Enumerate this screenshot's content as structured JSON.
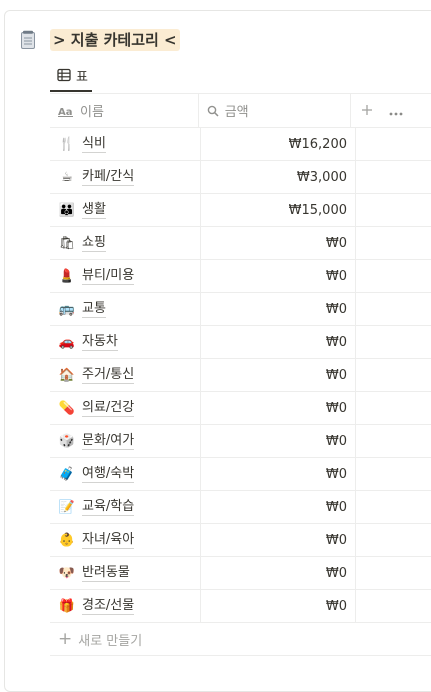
{
  "database": {
    "title": "> 지출 카테고리 <",
    "icon": "notepad-icon"
  },
  "view": {
    "tab_label": "표",
    "tab_icon": "table-icon"
  },
  "columns": {
    "name": {
      "label": "이름",
      "icon": "text-property-icon"
    },
    "amount": {
      "label": "금액",
      "icon": "search-icon"
    },
    "add_icon": "plus-icon",
    "more_icon": "more-horizontal-icon"
  },
  "rows": [
    {
      "emoji": "🍴",
      "name": "식비",
      "amount": "₩16,200"
    },
    {
      "emoji": "☕",
      "name": "카페/간식",
      "amount": "₩3,000"
    },
    {
      "emoji": "👪",
      "name": "생활",
      "amount": "₩15,000"
    },
    {
      "emoji": "🛍",
      "name": "쇼핑",
      "amount": "₩0"
    },
    {
      "emoji": "💄",
      "name": "뷰티/미용",
      "amount": "₩0"
    },
    {
      "emoji": "🚌",
      "name": "교통",
      "amount": "₩0"
    },
    {
      "emoji": "🚗",
      "name": "자동차",
      "amount": "₩0"
    },
    {
      "emoji": "🏠",
      "name": "주거/통신",
      "amount": "₩0"
    },
    {
      "emoji": "💊",
      "name": "의료/건강",
      "amount": "₩0"
    },
    {
      "emoji": "🎲",
      "name": "문화/여가",
      "amount": "₩0"
    },
    {
      "emoji": "🧳",
      "name": "여행/숙박",
      "amount": "₩0"
    },
    {
      "emoji": "📝",
      "name": "교육/학습",
      "amount": "₩0"
    },
    {
      "emoji": "👶",
      "name": "자녀/육아",
      "amount": "₩0"
    },
    {
      "emoji": "🐶",
      "name": "반려동물",
      "amount": "₩0"
    },
    {
      "emoji": "🎁",
      "name": "경조/선물",
      "amount": "₩0"
    }
  ],
  "new_row_label": "새로 만들기",
  "colors": {
    "title_highlight": "#fbecd3",
    "border": "#ededec",
    "muted_text": "#91918e",
    "text": "#37352f"
  }
}
